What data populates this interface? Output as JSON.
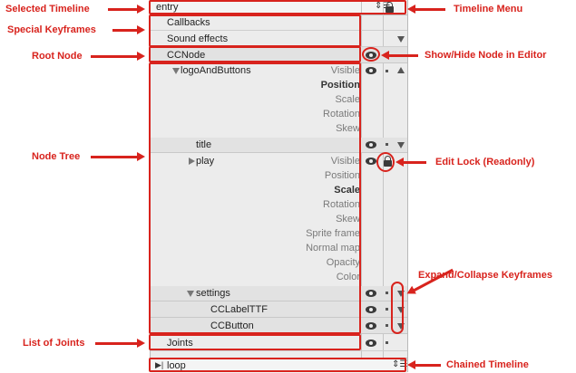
{
  "timeline_bar": {
    "selected": "entry",
    "lock_icon": "lock-icon",
    "menu_icon": "timeline-menu-icon"
  },
  "special_keyframes": {
    "callbacks": "Callbacks",
    "sound_effects": "Sound effects"
  },
  "node_tree": {
    "root": "CCNode",
    "logo": {
      "name": "logoAndButtons",
      "props": [
        "Visible",
        "Position",
        "Scale",
        "Rotation",
        "Skew"
      ]
    },
    "title": "title",
    "play": {
      "name": "play",
      "props": [
        "Visible",
        "Position",
        "Scale",
        "Rotation",
        "Skew",
        "Sprite frame",
        "Normal map",
        "Opacity",
        "Color"
      ]
    },
    "settings": "settings",
    "label": "CCLabelTTF",
    "button": "CCButton"
  },
  "joints": "Joints",
  "chained_timeline": {
    "value": "loop",
    "play_icon": "play-to-end-icon"
  },
  "annotations": {
    "selected_timeline": "Selected Timeline",
    "special_keyframes": "Special Keyframes",
    "root_node": "Root Node",
    "node_tree": "Node Tree",
    "list_of_joints": "List of Joints",
    "timeline_menu": "Timeline Menu",
    "show_hide": "Show/Hide Node in Editor",
    "edit_lock": "Edit Lock (Readonly)",
    "expand_collapse": "Expand/Collapse Keyframes",
    "chained_timeline": "Chained Timeline"
  },
  "colors": {
    "annotation": "#d8231d",
    "panel": "#ececec"
  }
}
